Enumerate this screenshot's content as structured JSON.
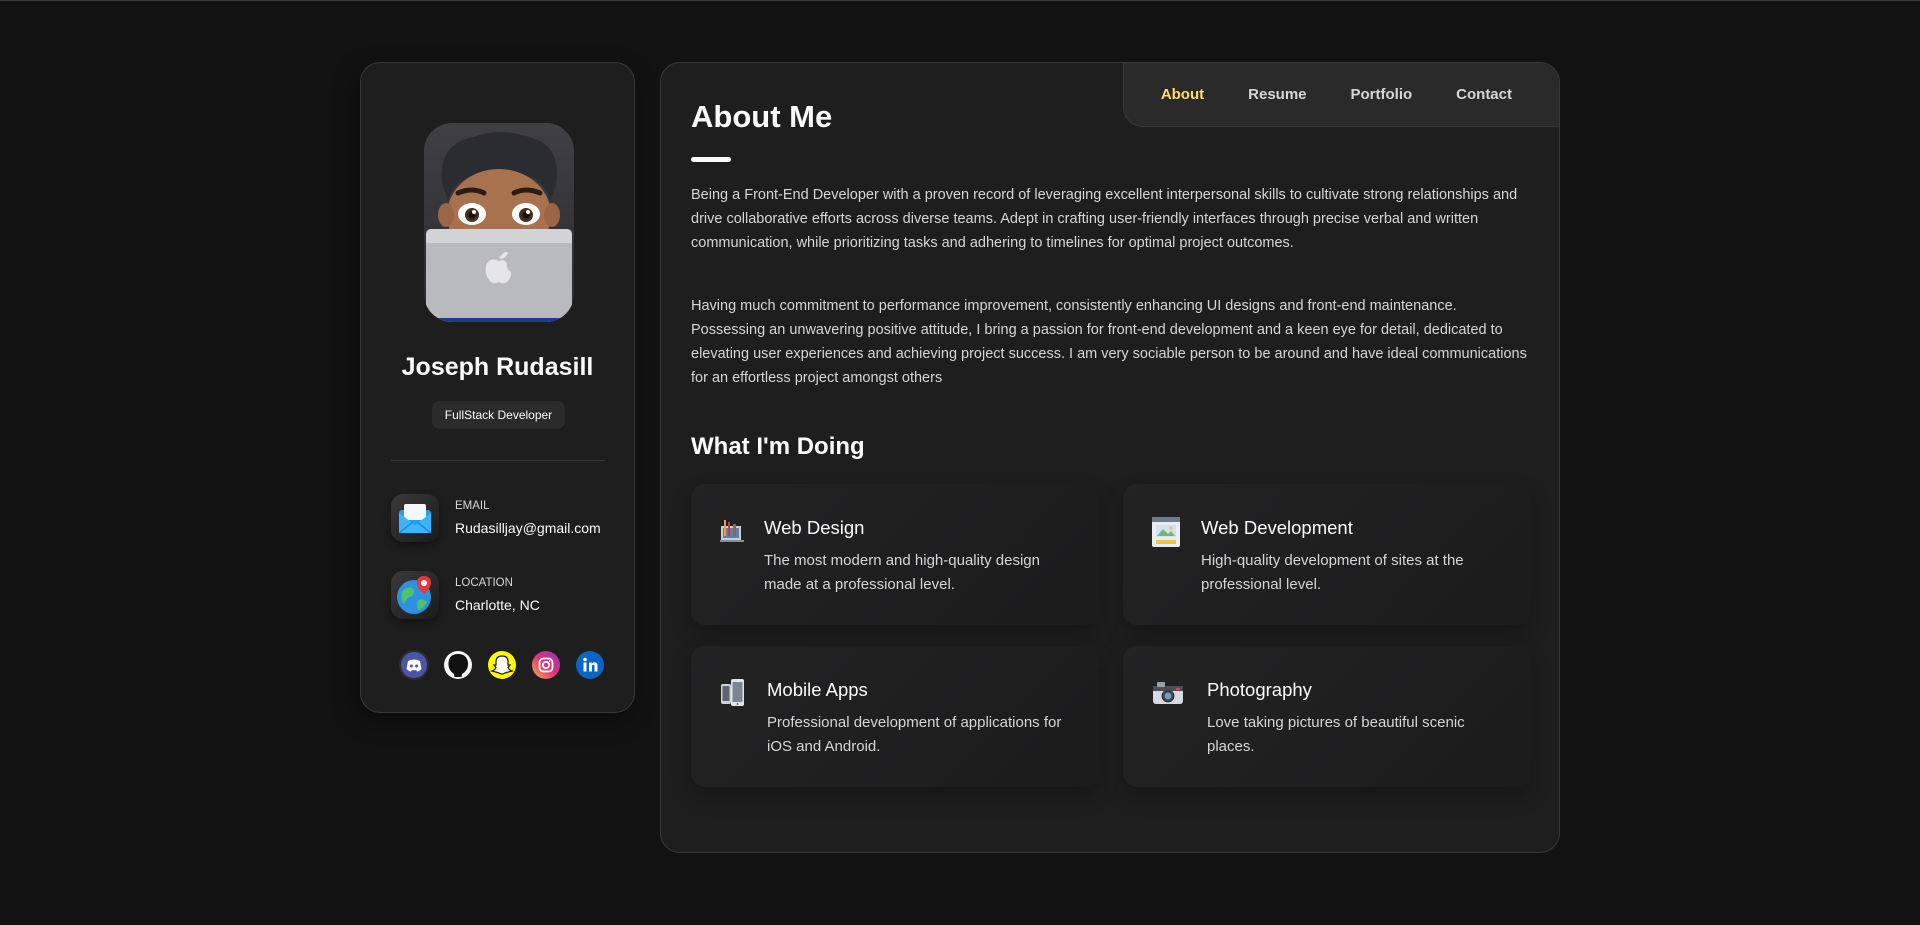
{
  "profile": {
    "name": "Joseph Rudasill",
    "title": "FullStack Developer",
    "avatar_icon": "memoji-laptop-avatar"
  },
  "contacts": {
    "email": {
      "label": "EMAIL",
      "value": "Rudasilljay@gmail.com",
      "icon": "envelope-icon"
    },
    "location": {
      "label": "LOCATION",
      "value": "Charlotte, NC",
      "icon": "globe-pin-icon"
    }
  },
  "socials": [
    {
      "name": "discord",
      "icon": "discord-icon",
      "color": "#5865f2"
    },
    {
      "name": "github",
      "icon": "github-icon",
      "color": "#ffffff"
    },
    {
      "name": "snapchat",
      "icon": "snapchat-icon",
      "color": "#fffc00"
    },
    {
      "name": "instagram",
      "icon": "instagram-icon",
      "color": "#d6249f"
    },
    {
      "name": "linkedin",
      "icon": "linkedin-icon",
      "color": "#0a66c2"
    }
  ],
  "nav": {
    "items": [
      {
        "label": "About",
        "active": true
      },
      {
        "label": "Resume",
        "active": false
      },
      {
        "label": "Portfolio",
        "active": false
      },
      {
        "label": "Contact",
        "active": false
      }
    ],
    "active_color": "#ffdb70"
  },
  "about": {
    "title": "About Me",
    "paragraphs": [
      "Being a Front-End Developer with a proven record of leveraging excellent interpersonal skills to cultivate strong relationships and drive collaborative efforts across diverse teams. Adept in crafting user-friendly interfaces through precise verbal and written communication, while prioritizing tasks and adhering to timelines for optimal project outcomes.",
      "Having much commitment to performance improvement, consistently enhancing UI designs and front-end maintenance. Possessing an unwavering positive attitude, I bring a passion for front-end development and a keen eye for detail, dedicated to elevating user experiences and achieving project success. I am very sociable person to be around and have ideal communications for an effortless project amongst others"
    ]
  },
  "services": {
    "title": "What I'm Doing",
    "items": [
      {
        "title": "Web Design",
        "text": "The most modern and high-quality design made at a professional level.",
        "icon": "design-tools-icon"
      },
      {
        "title": "Web Development",
        "text": "High-quality development of sites at the professional level.",
        "icon": "code-window-icon"
      },
      {
        "title": "Mobile Apps",
        "text": "Professional development of applications for iOS and Android.",
        "icon": "mobile-devices-icon"
      },
      {
        "title": "Photography",
        "text": "Love taking pictures of beautiful scenic places.",
        "icon": "camera-icon"
      }
    ]
  }
}
